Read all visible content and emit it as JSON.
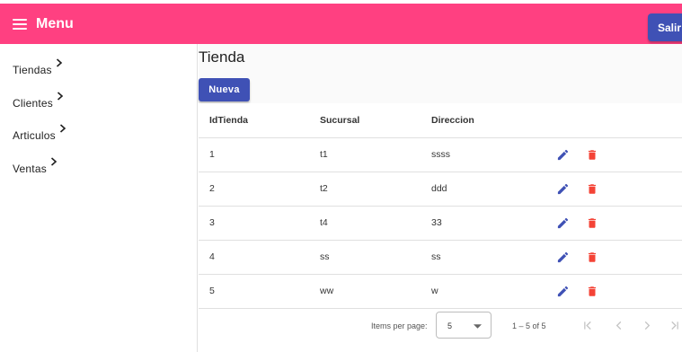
{
  "header": {
    "menu_label": "Menu",
    "logout_label": "Salir"
  },
  "sidebar": {
    "items": [
      {
        "label": "Tiendas"
      },
      {
        "label": "Clientes"
      },
      {
        "label": "Articulos"
      },
      {
        "label": "Ventas"
      }
    ]
  },
  "main": {
    "title": "Tienda",
    "new_label": "Nueva",
    "table": {
      "columns": [
        "IdTienda",
        "Sucursal",
        "Direccion"
      ],
      "rows": [
        [
          "1",
          "t1",
          "ssss"
        ],
        [
          "2",
          "t2",
          "ddd"
        ],
        [
          "3",
          "t4",
          "33"
        ],
        [
          "4",
          "ss",
          "ss"
        ],
        [
          "5",
          "ww",
          "w"
        ]
      ]
    },
    "paginator": {
      "items_per_page_label": "Items per page:",
      "page_size": "5",
      "range_label": "1 – 5 of 5"
    }
  },
  "colors": {
    "toolbar": "#ff4081",
    "primary": "#3f51b5",
    "delete": "#f44336",
    "disabled": "#c4c4c4"
  },
  "icons": {
    "menu": "menu-icon",
    "chevron": "chevron-right-icon",
    "edit": "pencil-icon",
    "delete": "trash-icon",
    "select_arrow": "caret-down-icon",
    "first": "first-page-icon",
    "prev": "chevron-left-icon",
    "next": "chevron-right-icon",
    "last": "last-page-icon"
  }
}
